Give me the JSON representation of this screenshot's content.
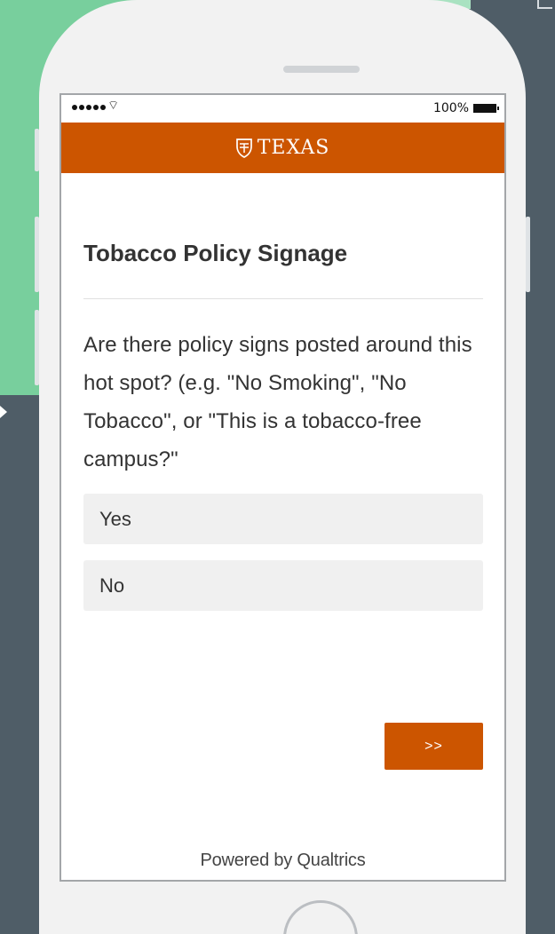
{
  "status_bar": {
    "signal_icon": "signal-dots-icon",
    "wifi_icon": "wifi-icon",
    "battery_percent": "100%",
    "battery_icon": "battery-full-icon"
  },
  "header": {
    "logo_text": "TEXAS",
    "logo_icon": "shield-icon",
    "accent_color": "#cc5500"
  },
  "survey": {
    "title": "Tobacco Policy Signage",
    "question": "Are there policy signs posted around this hot spot? (e.g. \"No Smoking\", \"No Tobacco\", or \"This is a tobacco-free campus?\"",
    "choices": [
      "Yes",
      "No"
    ],
    "next_label": ">>"
  },
  "footer": {
    "powered_by": "Powered by Qualtrics"
  }
}
